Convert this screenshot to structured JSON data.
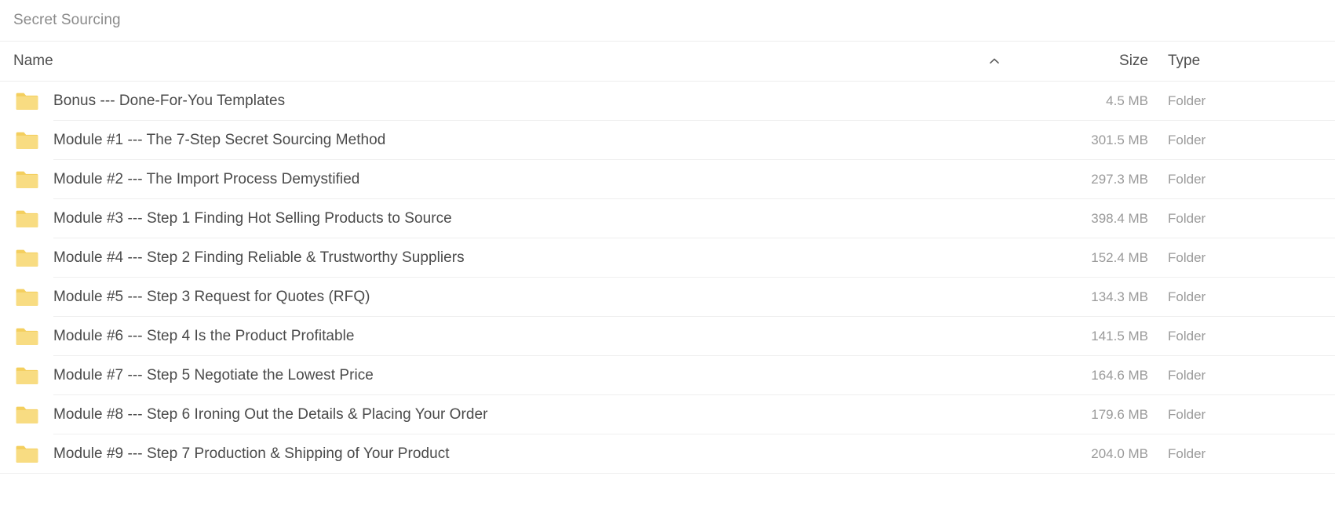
{
  "breadcrumb": {
    "current_folder": "Secret Sourcing"
  },
  "table": {
    "columns": {
      "name": "Name",
      "size": "Size",
      "type": "Type"
    },
    "sort": {
      "column": "Name",
      "direction": "ascending",
      "icon": "chevron-up-icon"
    },
    "row_icon": "folder-icon",
    "folder_icon_color": "#F4CF5E",
    "rows": [
      {
        "name": "Bonus --- Done-For-You Templates",
        "size": "4.5 MB",
        "type": "Folder"
      },
      {
        "name": "Module #1 --- The 7-Step Secret Sourcing Method",
        "size": "301.5 MB",
        "type": "Folder"
      },
      {
        "name": "Module #2 --- The Import Process Demystified",
        "size": "297.3 MB",
        "type": "Folder"
      },
      {
        "name": "Module #3 --- Step 1 Finding Hot Selling Products to Source",
        "size": "398.4 MB",
        "type": "Folder"
      },
      {
        "name": "Module #4 --- Step 2 Finding Reliable & Trustworthy Suppliers",
        "size": "152.4 MB",
        "type": "Folder"
      },
      {
        "name": "Module #5 --- Step 3 Request for Quotes (RFQ)",
        "size": "134.3 MB",
        "type": "Folder"
      },
      {
        "name": "Module #6 --- Step 4 Is the Product Profitable",
        "size": "141.5 MB",
        "type": "Folder"
      },
      {
        "name": "Module #7 --- Step 5 Negotiate the Lowest Price",
        "size": "164.6 MB",
        "type": "Folder"
      },
      {
        "name": "Module #8 --- Step 6 Ironing Out the Details & Placing Your Order",
        "size": "179.6 MB",
        "type": "Folder"
      },
      {
        "name": "Module #9 --- Step 7 Production & Shipping of Your Product",
        "size": "204.0 MB",
        "type": "Folder"
      }
    ]
  }
}
